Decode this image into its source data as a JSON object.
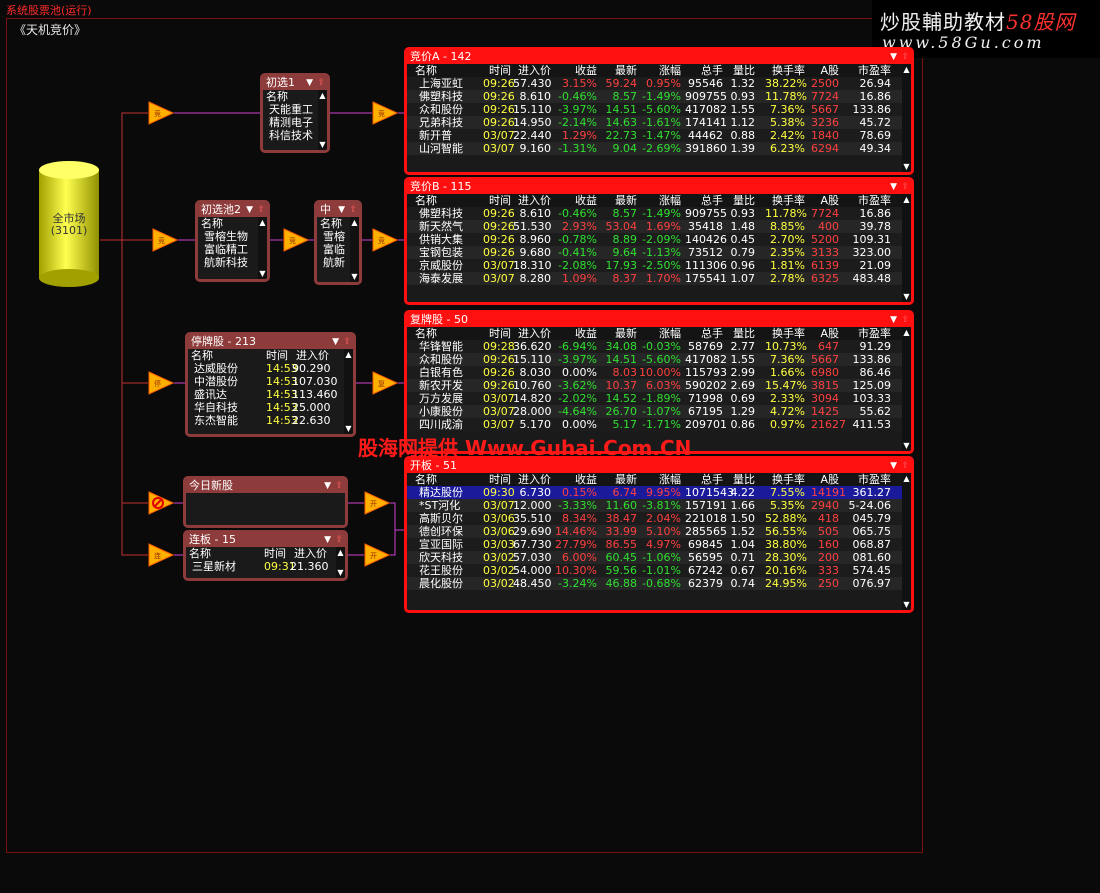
{
  "app_title": "系统股票池(运行)",
  "subtitle": "《天机竞价》",
  "logo": {
    "line1": "炒股輔助教材",
    "line1_accent": "58股网",
    "line2": "www.58Gu.com"
  },
  "watermark": "股海网提供 Www.Guhai.Com.CN",
  "market": {
    "name": "全市场",
    "count": "(3101)"
  },
  "colors": {
    "up": "#ff4040",
    "down": "#30e030",
    "flat": "#ffffff",
    "time": "#ffff40",
    "accent": "#ff1010"
  },
  "small_panels": [
    {
      "key": "chuxuan1",
      "title": "初选1",
      "cols": [
        "名称"
      ],
      "rows": [
        [
          "天能重工"
        ],
        [
          "精测电子"
        ],
        [
          "科信技术"
        ]
      ]
    },
    {
      "key": "chuxuan2",
      "title": "初选池2",
      "cols": [
        "名称"
      ],
      "rows": [
        [
          "雪榕生物"
        ],
        [
          "富临精工"
        ],
        [
          "航新科技"
        ]
      ]
    },
    {
      "key": "zhong",
      "title": "中",
      "cols": [
        "名称"
      ],
      "rows": [
        [
          "雪榕"
        ],
        [
          "富临"
        ],
        [
          "航新"
        ]
      ]
    },
    {
      "key": "tingpai",
      "title": "停牌股 - 213",
      "cols": [
        "名称",
        "时间",
        "进入价"
      ],
      "rows": [
        [
          "达威股份",
          "14:53",
          "90.290"
        ],
        [
          "中潜股份",
          "14:53",
          "107.030"
        ],
        [
          "盛讯达",
          "14:53",
          "113.460"
        ],
        [
          "华自科技",
          "14:53",
          "25.000"
        ],
        [
          "东杰智能",
          "14:53",
          "22.630"
        ]
      ]
    },
    {
      "key": "jinri",
      "title": "今日新股",
      "cols": [],
      "rows": []
    },
    {
      "key": "lianban",
      "title": "连板 - 15",
      "cols": [
        "名称",
        "时间",
        "进入价"
      ],
      "rows": [
        [
          "三星新材",
          "09:31",
          "21.360"
        ]
      ]
    }
  ],
  "big_columns": [
    "名称",
    "时间",
    "进入价",
    "收益",
    "最新",
    "涨幅",
    "总手",
    "量比",
    "换手率",
    "A股",
    "市盈率"
  ],
  "big_panels": [
    {
      "key": "jjA",
      "title": "竞价A - 142",
      "rows": [
        [
          "上海亚虹",
          "09:26",
          "57.430",
          "3.15%",
          "59.24",
          "0.95%",
          "95546",
          "1.32",
          "38.22%",
          "2500",
          "26.94"
        ],
        [
          "佛塑科技",
          "09:26",
          "8.610",
          "-0.46%",
          "8.57",
          "-1.49%",
          "909755",
          "0.93",
          "11.78%",
          "7724",
          "16.86"
        ],
        [
          "众和股份",
          "09:26",
          "15.110",
          "-3.97%",
          "14.51",
          "-5.60%",
          "417082",
          "1.55",
          "7.36%",
          "5667",
          "133.86"
        ],
        [
          "兄弟科技",
          "09:26",
          "14.950",
          "-2.14%",
          "14.63",
          "-1.61%",
          "174141",
          "1.12",
          "5.38%",
          "3236",
          "45.72"
        ],
        [
          "新开普",
          "03/07",
          "22.440",
          "1.29%",
          "22.73",
          "-1.47%",
          "44462",
          "0.88",
          "2.42%",
          "1840",
          "78.69"
        ],
        [
          "山河智能",
          "03/07",
          "9.160",
          "-1.31%",
          "9.04",
          "-2.69%",
          "391860",
          "1.39",
          "6.23%",
          "6294",
          "49.34"
        ]
      ]
    },
    {
      "key": "jjB",
      "title": "竞价B - 115",
      "rows": [
        [
          "佛塑科技",
          "09:26",
          "8.610",
          "-0.46%",
          "8.57",
          "-1.49%",
          "909755",
          "0.93",
          "11.78%",
          "7724",
          "16.86"
        ],
        [
          "新天然气",
          "09:26",
          "51.530",
          "2.93%",
          "53.04",
          "1.69%",
          "35418",
          "1.48",
          "8.85%",
          "400",
          "39.78"
        ],
        [
          "供销大集",
          "09:26",
          "8.960",
          "-0.78%",
          "8.89",
          "-2.09%",
          "140426",
          "0.45",
          "2.70%",
          "5200",
          "109.31"
        ],
        [
          "宝钢包装",
          "09:26",
          "9.680",
          "-0.41%",
          "9.64",
          "-1.13%",
          "73512",
          "0.79",
          "2.35%",
          "3133",
          "323.00"
        ],
        [
          "京威股份",
          "03/07",
          "18.310",
          "-2.08%",
          "17.93",
          "-2.50%",
          "111306",
          "0.96",
          "1.81%",
          "6139",
          "21.09"
        ],
        [
          "海泰发展",
          "03/07",
          "8.280",
          "1.09%",
          "8.37",
          "1.70%",
          "175541",
          "1.07",
          "2.78%",
          "6325",
          "483.48"
        ]
      ]
    },
    {
      "key": "fupai",
      "title": "复牌股 - 50",
      "rows": [
        [
          "华锋智能",
          "09:28",
          "36.620",
          "-6.94%",
          "34.08",
          "-0.03%",
          "58769",
          "2.77",
          "10.73%",
          "647",
          "91.29"
        ],
        [
          "众和股份",
          "09:26",
          "15.110",
          "-3.97%",
          "14.51",
          "-5.60%",
          "417082",
          "1.55",
          "7.36%",
          "5667",
          "133.86"
        ],
        [
          "白银有色",
          "09:26",
          "8.030",
          "0.00%",
          "8.03",
          "10.00%",
          "115793",
          "2.99",
          "1.66%",
          "6980",
          "86.46"
        ],
        [
          "新农开发",
          "09:26",
          "10.760",
          "-3.62%",
          "10.37",
          "6.03%",
          "590202",
          "2.69",
          "15.47%",
          "3815",
          "125.09"
        ],
        [
          "万方发展",
          "03/07",
          "14.820",
          "-2.02%",
          "14.52",
          "-1.89%",
          "71998",
          "0.69",
          "2.33%",
          "3094",
          "103.33"
        ],
        [
          "小康股份",
          "03/07",
          "28.000",
          "-4.64%",
          "26.70",
          "-1.07%",
          "67195",
          "1.29",
          "4.72%",
          "1425",
          "55.62"
        ],
        [
          "四川成渝",
          "03/07",
          "5.170",
          "0.00%",
          "5.17",
          "-1.71%",
          "209701",
          "0.86",
          "0.97%",
          "21627",
          "411.53"
        ]
      ]
    },
    {
      "key": "kaiban",
      "title": "开板 - 51",
      "rows": [
        [
          "精达股份",
          "09:30",
          "6.730",
          "0.15%",
          "6.74",
          "9.95%",
          "1071543",
          "4.22",
          "7.55%",
          "14191",
          "361.27"
        ],
        [
          "*ST河化",
          "03/07",
          "12.000",
          "-3.33%",
          "11.60",
          "-3.81%",
          "157191",
          "1.66",
          "5.35%",
          "2940",
          "5-24.06"
        ],
        [
          "高斯贝尔",
          "03/06",
          "35.510",
          "8.34%",
          "38.47",
          "2.04%",
          "221018",
          "1.50",
          "52.88%",
          "418",
          "045.79"
        ],
        [
          "德创环保",
          "03/06",
          "29.690",
          "14.46%",
          "33.99",
          "5.10%",
          "285565",
          "1.52",
          "56.55%",
          "505",
          "065.75"
        ],
        [
          "宣亚国际",
          "03/03",
          "67.730",
          "27.79%",
          "86.55",
          "4.97%",
          "69845",
          "1.04",
          "38.80%",
          "160",
          "068.87"
        ],
        [
          "欣天科技",
          "03/02",
          "57.030",
          "6.00%",
          "60.45",
          "-1.06%",
          "56595",
          "0.71",
          "28.30%",
          "200",
          "081.60"
        ],
        [
          "花王股份",
          "03/02",
          "54.000",
          "10.30%",
          "59.56",
          "-1.01%",
          "67242",
          "0.67",
          "20.16%",
          "333",
          "574.45"
        ],
        [
          "晨化股份",
          "03/02",
          "48.450",
          "-3.24%",
          "46.88",
          "-0.68%",
          "62379",
          "0.74",
          "24.95%",
          "250",
          "076.97"
        ]
      ]
    }
  ]
}
